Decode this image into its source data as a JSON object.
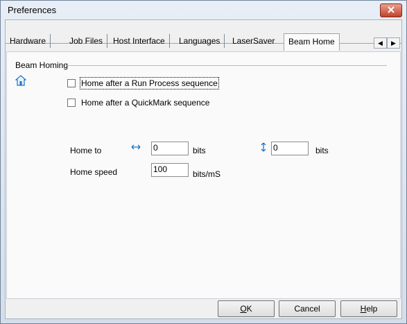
{
  "window": {
    "title": "Preferences"
  },
  "tabs": [
    {
      "label": "Hardware"
    },
    {
      "label": "Job Files"
    },
    {
      "label": "Host Interface"
    },
    {
      "label": "Languages"
    },
    {
      "label": "LaserSaver"
    },
    {
      "label": "Beam Home",
      "active": true
    }
  ],
  "group": {
    "title": "Beam Homing"
  },
  "checkboxes": {
    "run_process": {
      "label": "Home after a Run Process sequence",
      "checked": false
    },
    "quickmark": {
      "label": "Home after a QuickMark sequence",
      "checked": false
    }
  },
  "home_to": {
    "label": "Home to",
    "x_value": "0",
    "y_value": "0",
    "unit": "bits"
  },
  "home_speed": {
    "label": "Home speed",
    "value": "100",
    "unit": "bits/mS"
  },
  "buttons": {
    "ok": {
      "mnemonic": "O",
      "rest": "K"
    },
    "cancel": {
      "label": "Cancel"
    },
    "help": {
      "mnemonic": "H",
      "rest": "elp"
    }
  },
  "colors": {
    "close_button": "#c2412a",
    "icon_blue": "#1e74c8"
  }
}
